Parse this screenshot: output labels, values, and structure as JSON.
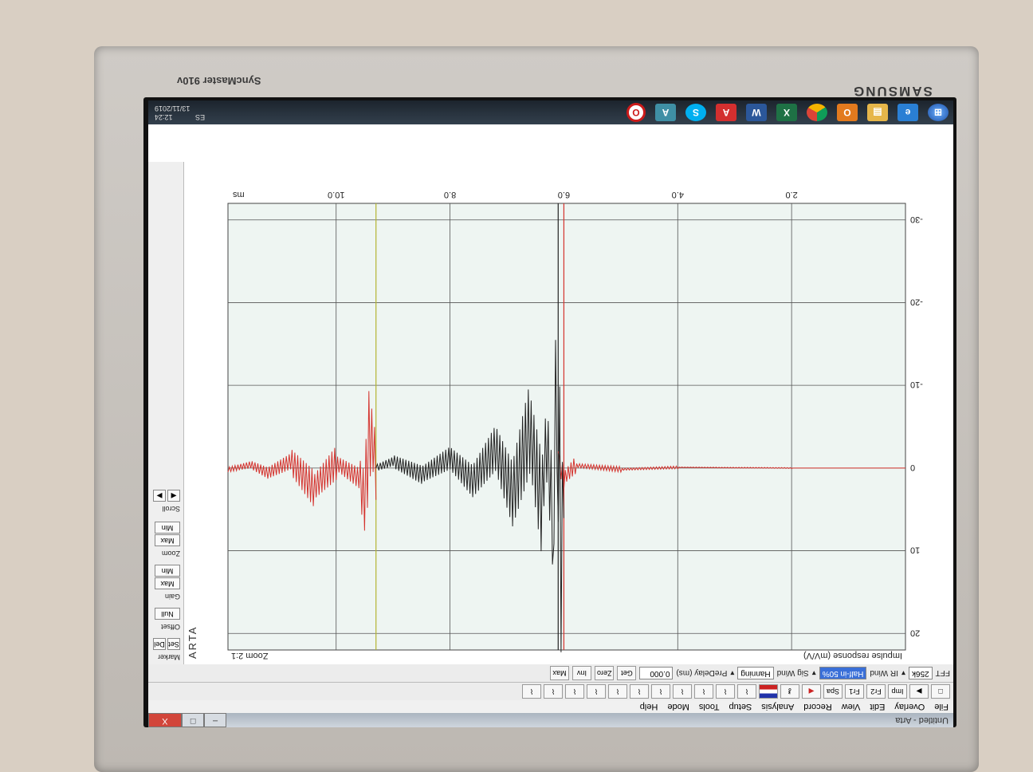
{
  "monitor": {
    "brand": "SAMSUNG",
    "model": "SyncMaster 910v"
  },
  "window": {
    "title": "Untitled - Arta",
    "minimize": "–",
    "maximize": "□",
    "close": "X"
  },
  "menu": [
    "File",
    "Overlay",
    "Edit",
    "View",
    "Record",
    "Analysis",
    "Setup",
    "Tools",
    "Mode",
    "Help"
  ],
  "toolbar1": {
    "imp_label": "Imp",
    "fr2_label": "Fr2",
    "fr1_label": "Fr1",
    "spa_label": "Spa"
  },
  "toolbar2": {
    "fft_label": "FFT",
    "fft_value": "256k",
    "ir_wind_label": "IR Wind",
    "ir_wind_value": "Half-in 50%",
    "sig_wind_label": "Sig Wind",
    "sig_wind_value": "Hanning",
    "predelay_label": "PreDelay (ms)",
    "predelay_value": "0.000",
    "get_label": "Get",
    "zero_label": "Zero",
    "inv_label": "Inv",
    "max_label": "Max"
  },
  "side_panel": {
    "marker_label": "Marker",
    "set_label": "Set",
    "del_label": "Del",
    "offset_label": "Offset",
    "null_label": "Null",
    "gain_label": "Gain",
    "max_label": "Max",
    "min_label": "Min",
    "zoom_label": "Zoom",
    "scroll_label": "Scroll"
  },
  "plot": {
    "vertical_brand": "ARTA",
    "zoom_text": "Zoom 2:1",
    "ylabel": "Impulse response (mV/V)",
    "x_unit": "ms"
  },
  "chart_data": {
    "type": "line",
    "xlabel": "ms",
    "ylabel": "Impulse response (mV/V)",
    "xlim": [
      0,
      11.9
    ],
    "ylim": [
      -32,
      22
    ],
    "x_ticks": [
      "2.0",
      "4.0",
      "6.0",
      "8.0",
      "10.0"
    ],
    "y_ticks": [
      "-30",
      "-20",
      "-10",
      "0",
      "10",
      "20"
    ],
    "grid": true,
    "markers": [
      {
        "color": "#d4332e",
        "x": 6.0
      },
      {
        "color": "#222222",
        "x": 6.1
      },
      {
        "color": "#b4b432",
        "x": 9.3
      }
    ],
    "series": [
      {
        "color": "#d4332e",
        "values": [
          [
            0.0,
            0.0
          ],
          [
            2.0,
            0.0
          ],
          [
            4.0,
            -0.2
          ],
          [
            5.0,
            0.4
          ],
          [
            5.8,
            -0.8
          ],
          [
            6.0,
            3.0
          ],
          [
            6.1,
            -2.0
          ]
        ]
      },
      {
        "color": "#222222",
        "values": [
          [
            6.0,
            0.0
          ],
          [
            6.05,
            22.0
          ],
          [
            6.12,
            -27.0
          ],
          [
            6.2,
            14.0
          ],
          [
            6.3,
            -8.0
          ],
          [
            6.4,
            10.0
          ],
          [
            6.6,
            -12.0
          ],
          [
            6.9,
            8.0
          ],
          [
            7.2,
            -6.0
          ],
          [
            7.6,
            4.0
          ],
          [
            8.0,
            -3.0
          ],
          [
            8.5,
            2.0
          ],
          [
            9.0,
            -2.0
          ],
          [
            9.3,
            0.0
          ]
        ]
      },
      {
        "color": "#d4332e",
        "values": [
          [
            9.3,
            0.0
          ],
          [
            9.4,
            -14.0
          ],
          [
            9.5,
            10.0
          ],
          [
            9.6,
            3.0
          ],
          [
            10.0,
            -1.5
          ],
          [
            10.4,
            6.0
          ],
          [
            10.8,
            -2.0
          ],
          [
            11.2,
            1.5
          ],
          [
            11.5,
            -1.0
          ],
          [
            11.9,
            0.5
          ]
        ]
      }
    ]
  },
  "taskbar": {
    "time": "12:24",
    "date": "13/11/2019",
    "lang": "ES",
    "icons": [
      "windows-start-icon",
      "ie-icon",
      "explorer-icon",
      "office-icon",
      "chrome-icon",
      "excel-icon",
      "word-icon",
      "acrobat-icon",
      "skype-icon",
      "arta-icon",
      "opera-icon"
    ]
  }
}
